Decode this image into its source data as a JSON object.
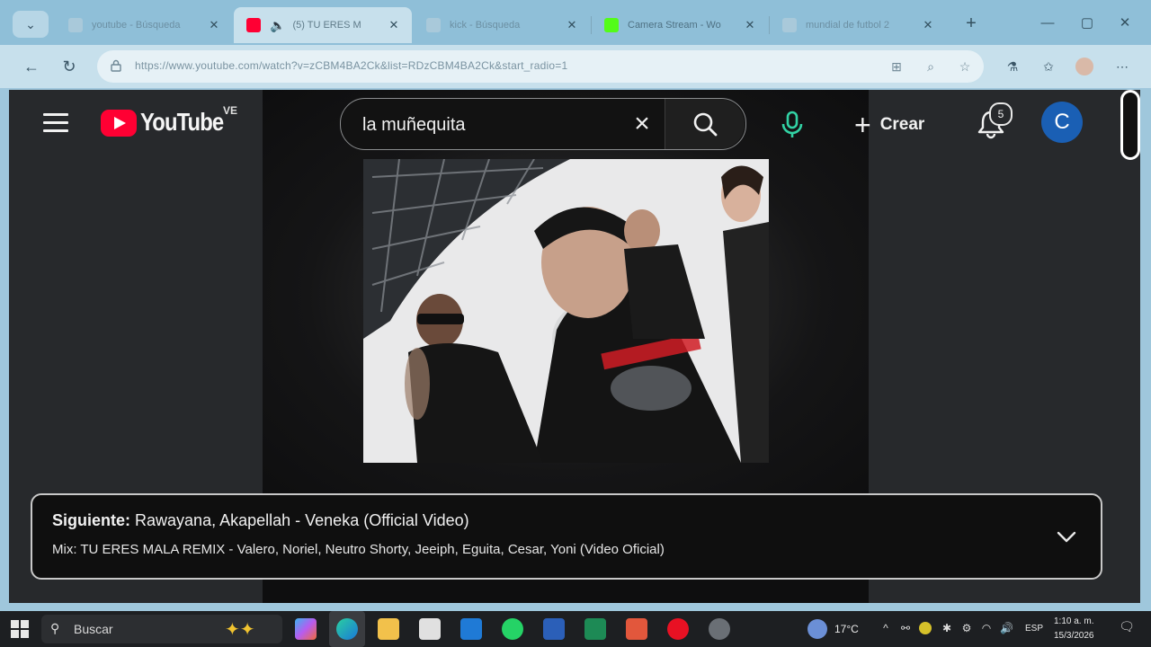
{
  "browser": {
    "tabs": [
      {
        "title": "youtube - Búsqueda",
        "icon": "search-favicon"
      },
      {
        "title": "(5) TU ERES M",
        "icon": "youtube-favicon",
        "audio": true
      },
      {
        "title": "kick - Búsqueda",
        "icon": "search-favicon"
      },
      {
        "title": "Camera Stream - Wo",
        "icon": "kick-favicon"
      },
      {
        "title": "mundial de futbol 2",
        "icon": "search-favicon"
      }
    ],
    "url": "https://www.youtube.com/watch?v=zCBM4BA2Ck&list=RDzCBM4BA2Ck&start_radio=1"
  },
  "youtube": {
    "country_code": "VE",
    "search_query": "la muñequita",
    "create_label": "Crear",
    "notification_count": "5",
    "avatar_letter": "C",
    "upnext": {
      "prefix": "Siguiente:",
      "title": "Rawayana, Akapellah - Veneka (Official Video)",
      "playlist": "Mix: TU ERES MALA REMIX - Valero, Noriel, Neutro Shorty, Jeeiph, Eguita, Cesar, Yoni (Video Oficial)"
    }
  },
  "taskbar": {
    "search_placeholder": "Buscar",
    "temperature": "17°C",
    "language": "ESP",
    "time": "1:10 a. m.",
    "date": "15/3/2026"
  },
  "colors": {
    "youtube_red": "#ff0033",
    "mic_accent": "#32d2a4",
    "avatar_bg": "#1a5fb4"
  }
}
